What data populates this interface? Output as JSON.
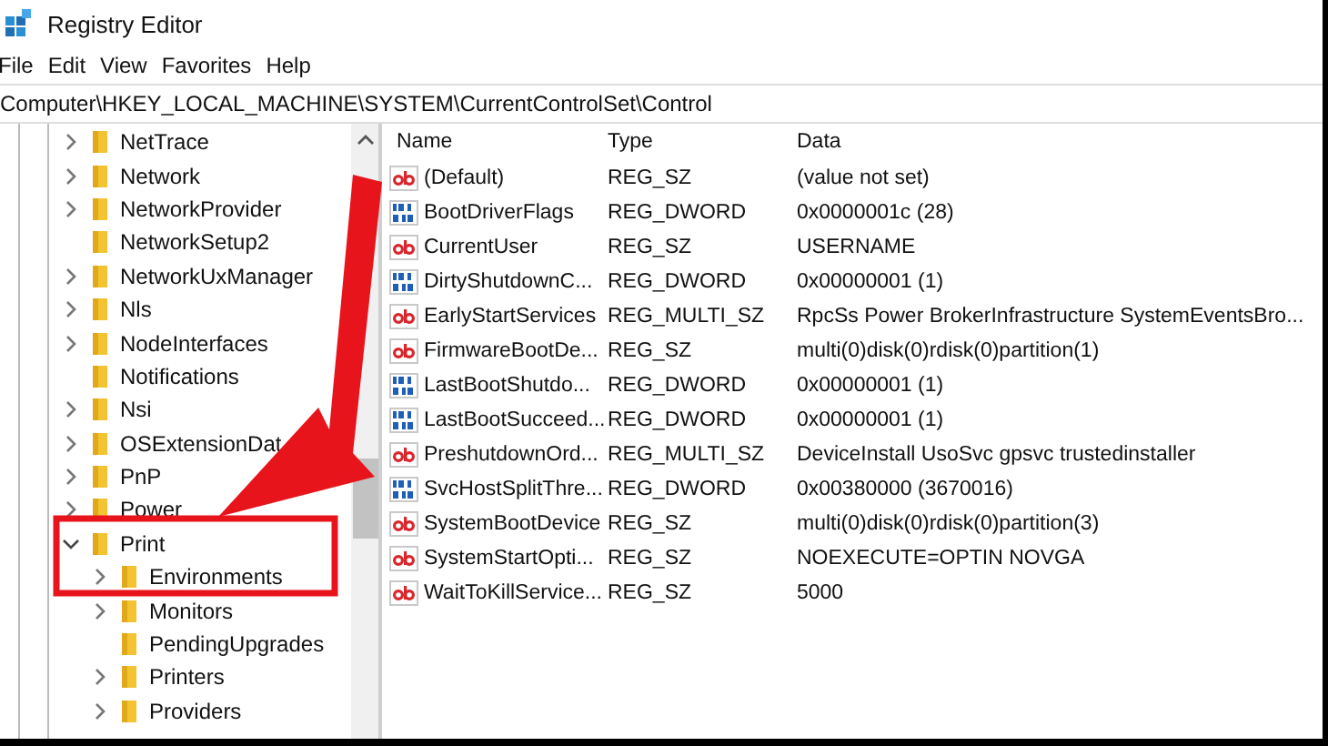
{
  "window": {
    "title": "Registry Editor"
  },
  "menu": [
    "File",
    "Edit",
    "View",
    "Favorites",
    "Help"
  ],
  "address": "Computer\\HKEY_LOCAL_MACHINE\\SYSTEM\\CurrentControlSet\\Control",
  "tree": [
    {
      "label": "NetTrace",
      "kind": "branch",
      "expanded": false
    },
    {
      "label": "Network",
      "kind": "branch",
      "expanded": false
    },
    {
      "label": "NetworkProvider",
      "kind": "branch",
      "expanded": false
    },
    {
      "label": "NetworkSetup2",
      "kind": "leaf"
    },
    {
      "label": "NetworkUxManager",
      "kind": "branch",
      "expanded": false
    },
    {
      "label": "Nls",
      "kind": "branch",
      "expanded": false
    },
    {
      "label": "NodeInterfaces",
      "kind": "branch",
      "expanded": false
    },
    {
      "label": "Notifications",
      "kind": "leaf"
    },
    {
      "label": "Nsi",
      "kind": "branch",
      "expanded": false
    },
    {
      "label": "OSExtensionDat",
      "kind": "branch",
      "expanded": false
    },
    {
      "label": "PnP",
      "kind": "branch",
      "expanded": false
    },
    {
      "label": "Power",
      "kind": "branch",
      "expanded": false
    },
    {
      "label": "Print",
      "kind": "branch",
      "expanded": true,
      "children": [
        {
          "label": "Environments",
          "kind": "branch",
          "expanded": false
        },
        {
          "label": "Monitors",
          "kind": "branch",
          "expanded": false
        },
        {
          "label": "PendingUpgrades",
          "kind": "leaf"
        },
        {
          "label": "Printers",
          "kind": "branch",
          "expanded": false
        },
        {
          "label": "Providers",
          "kind": "branch",
          "expanded": false
        }
      ]
    }
  ],
  "table": {
    "columns": [
      "Name",
      "Type",
      "Data"
    ],
    "rows": [
      {
        "kind": "string",
        "name": "(Default)",
        "type": "REG_SZ",
        "data": "(value not set)"
      },
      {
        "kind": "binary",
        "name": "BootDriverFlags",
        "type": "REG_DWORD",
        "data": "0x0000001c (28)"
      },
      {
        "kind": "string",
        "name": "CurrentUser",
        "type": "REG_SZ",
        "data": "USERNAME"
      },
      {
        "kind": "binary",
        "name": "DirtyShutdownC...",
        "type": "REG_DWORD",
        "data": "0x00000001 (1)"
      },
      {
        "kind": "string",
        "name": "EarlyStartServices",
        "type": "REG_MULTI_SZ",
        "data": "RpcSs Power BrokerInfrastructure SystemEventsBro..."
      },
      {
        "kind": "string",
        "name": "FirmwareBootDe...",
        "type": "REG_SZ",
        "data": "multi(0)disk(0)rdisk(0)partition(1)"
      },
      {
        "kind": "binary",
        "name": "LastBootShutdo...",
        "type": "REG_DWORD",
        "data": "0x00000001 (1)"
      },
      {
        "kind": "binary",
        "name": "LastBootSucceed...",
        "type": "REG_DWORD",
        "data": "0x00000001 (1)"
      },
      {
        "kind": "string",
        "name": "PreshutdownOrd...",
        "type": "REG_MULTI_SZ",
        "data": "DeviceInstall UsoSvc gpsvc trustedinstaller"
      },
      {
        "kind": "binary",
        "name": "SvcHostSplitThre...",
        "type": "REG_DWORD",
        "data": "0x00380000 (3670016)"
      },
      {
        "kind": "string",
        "name": "SystemBootDevice",
        "type": "REG_SZ",
        "data": "multi(0)disk(0)rdisk(0)partition(3)"
      },
      {
        "kind": "string",
        "name": "SystemStartOpti...",
        "type": "REG_SZ",
        "data": " NOEXECUTE=OPTIN  NOVGA"
      },
      {
        "kind": "string",
        "name": "WaitToKillService...",
        "type": "REG_SZ",
        "data": "5000"
      }
    ]
  }
}
